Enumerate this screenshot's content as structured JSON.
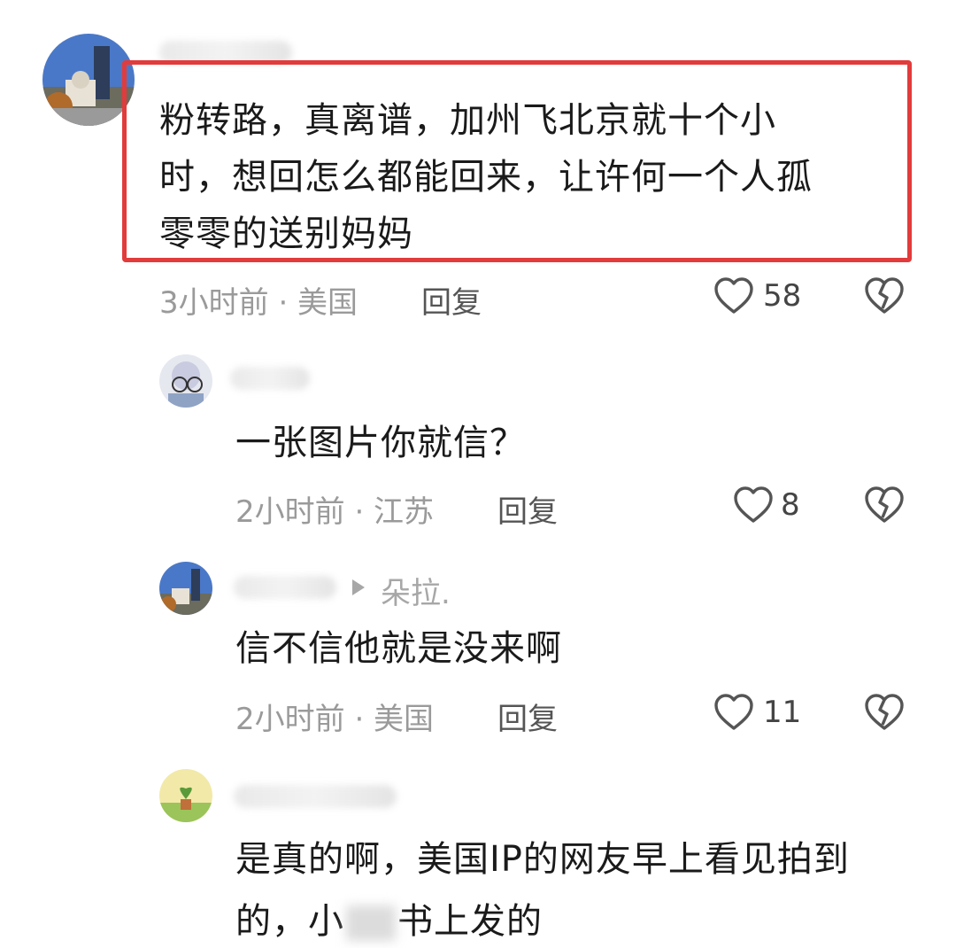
{
  "comments": [
    {
      "text": "粉转路，真离谱，加州飞北京就十个小时，想回怎么都能回来，让许何一个人孤零零的送别妈妈",
      "lines": [
        "粉转路，真离谱，加州飞北京就十个小",
        "时，想回怎么都能回来，让许何一个人孤",
        "零零的送别妈妈"
      ],
      "meta": "3小时前 · 美国",
      "reply_label": "回复",
      "likes": "58",
      "highlighted": true
    },
    {
      "text": "一张图片你就信？",
      "meta": "2小时前 · 江苏",
      "reply_label": "回复",
      "likes": "8"
    },
    {
      "reply_to_user": "朵拉.",
      "text": "信不信他就是没来啊",
      "meta": "2小时前 · 美国",
      "reply_label": "回复",
      "likes": "11"
    },
    {
      "lines": [
        "是真的啊，美国IP的网友早上看见拍到",
        "的，小",
        "书上发的"
      ]
    }
  ],
  "icons": {
    "like": "heart-outline-icon",
    "dislike": "broken-heart-icon",
    "reply_arrow": "triangle-right-icon"
  },
  "colors": {
    "highlight_border": "#e23b3b",
    "meta_text": "#9a9a9a"
  }
}
